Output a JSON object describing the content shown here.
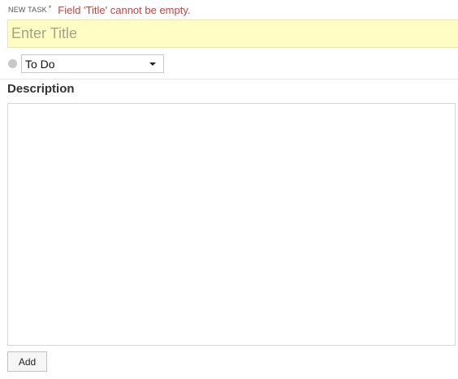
{
  "header": {
    "new_task_label": "NEW TASK",
    "required_marker": "*",
    "error_message": "Field 'Title' cannot be empty."
  },
  "title_field": {
    "placeholder": "Enter Title",
    "value": ""
  },
  "status": {
    "selected": "To Do",
    "dot_color": "#c9c9c9"
  },
  "description": {
    "heading": "Description",
    "value": ""
  },
  "actions": {
    "add_label": "Add"
  },
  "colors": {
    "error": "#c8423f",
    "title_highlight": "#fffdc4"
  }
}
